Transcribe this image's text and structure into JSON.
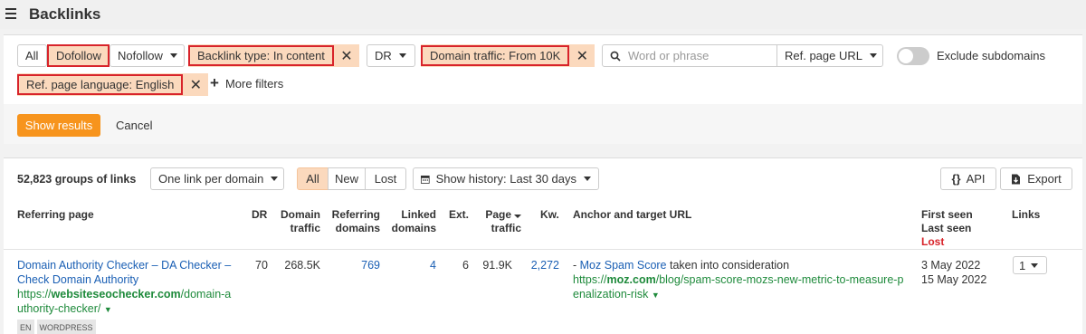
{
  "header": {
    "title": "Backlinks"
  },
  "filters": {
    "all": "All",
    "dofollow": "Dofollow",
    "nofollow": "Nofollow",
    "backlink_type": "Backlink type: In content",
    "dr": "DR",
    "domain_traffic": "Domain traffic: From 10K",
    "search_placeholder": "Word or phrase",
    "ref_page_url": "Ref. page URL",
    "exclude_subdomains": "Exclude subdomains",
    "page_language": "Ref. page language: English",
    "more_filters": "More filters",
    "show_results": "Show results",
    "cancel": "Cancel",
    "close_glyph": "✕",
    "plus_glyph": "+"
  },
  "results": {
    "count": "52,823 groups of links",
    "grouping": "One link per domain",
    "seg_all": "All",
    "seg_new": "New",
    "seg_lost": "Lost",
    "history": "Show history: Last 30 days",
    "api": "API",
    "export": "Export"
  },
  "table": {
    "headers": {
      "referring_page": "Referring page",
      "dr": "DR",
      "domain_traffic_1": "Domain",
      "domain_traffic_2": "traffic",
      "ref_domains_1": "Referring",
      "ref_domains_2": "domains",
      "linked_domains_1": "Linked",
      "linked_domains_2": "domains",
      "ext": "Ext.",
      "page_traffic_1": "Page",
      "page_traffic_2": "traffic",
      "kw": "Kw.",
      "anchor": "Anchor and target URL",
      "first_seen": "First seen",
      "last_seen": "Last seen",
      "lost": "Lost",
      "links": "Links"
    },
    "row": {
      "title_line1": "Domain Authority Checker – DA Checker –",
      "title_line2": "Check Domain Authority",
      "url_prefix": "https://",
      "url_domain": "websiteseochecker.com",
      "url_path1": "/domain-a",
      "url_path2": "uthority-checker/",
      "tag1": "EN",
      "tag2": "WORDPRESS",
      "dr": "70",
      "domain_traffic": "268.5K",
      "ref_domains": "769",
      "linked_domains": "4",
      "ext": "6",
      "page_traffic": "91.9K",
      "kw": "2,272",
      "anchor_dash": "- ",
      "anchor_text": "Moz Spam Score",
      "anchor_rest": " taken into consideration",
      "target_prefix": "https://",
      "target_domain": "moz.com",
      "target_path1": "/blog/spam-score-mozs-new-metric-to-measure-p",
      "target_path2": "enalization-risk",
      "first_seen": "3 May 2022",
      "last_seen": "15 May 2022",
      "links": "1"
    }
  },
  "colors": {
    "accent": "#f7941d",
    "chip": "#fbd9bd",
    "highlight_border": "#d8232a",
    "link": "#1a5fb4",
    "url_green": "#1e8a3b",
    "lost_red": "#d8232a"
  }
}
